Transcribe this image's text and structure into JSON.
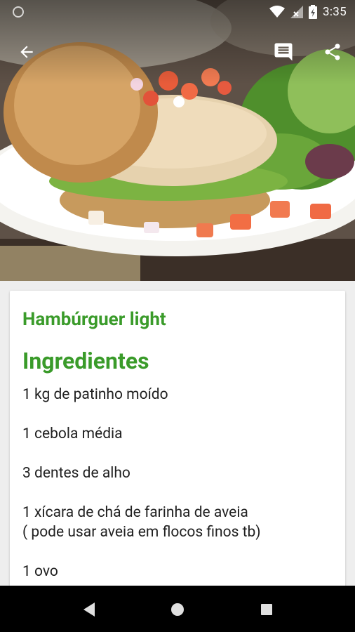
{
  "status_bar": {
    "time": "3:35",
    "icons": [
      "wifi-icon",
      "signal-icon",
      "battery-icon"
    ]
  },
  "toolbar": {
    "icons": [
      "back-arrow-icon",
      "comment-icon",
      "share-icon"
    ]
  },
  "recipe": {
    "title": "Hambúrguer light",
    "section_title": "Ingredientes",
    "ingredients": [
      "1 kg de patinho moído",
      "1 cebola média",
      "3 dentes de alho",
      "1 xícara de chá de farinha de aveia\n( pode usar aveia em flocos finos tb)",
      "1 ovo"
    ]
  },
  "colors": {
    "accent": "#3a9b2a",
    "text": "#212121",
    "background": "#eeeeee"
  },
  "nav_bar": {
    "icons": [
      "back-triangle-icon",
      "home-circle-icon",
      "recents-square-icon"
    ]
  }
}
